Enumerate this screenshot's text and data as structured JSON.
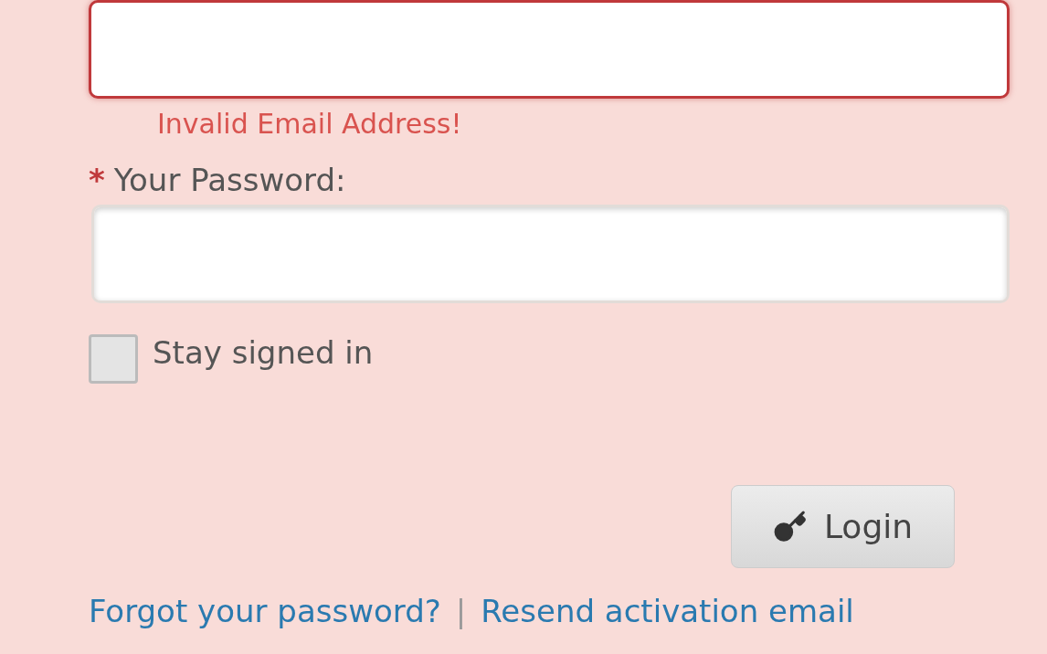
{
  "email_field": {
    "invalid": true,
    "error": "Invalid Email Address!"
  },
  "password_field": {
    "required_mark": "*",
    "label": "Your Password:",
    "invalid": false
  },
  "stay_signed_in": {
    "label": "Stay signed in",
    "checked": false
  },
  "login_button": {
    "label": "Login"
  },
  "links": [
    {
      "label": "Forgot your password?"
    },
    {
      "label": "Resend activation email"
    }
  ],
  "link_separator": "|"
}
